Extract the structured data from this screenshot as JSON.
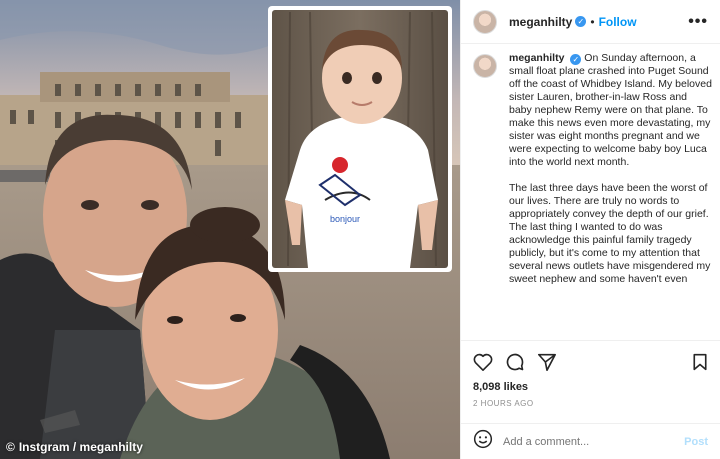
{
  "photo": {
    "credit": "Instgram / meganhilty",
    "child_shirt_text": "bonjour"
  },
  "header": {
    "username": "meganhilty",
    "separator": "•",
    "follow_label": "Follow",
    "more_label": "•••"
  },
  "caption": {
    "username": "meganhilty",
    "paragraph_1": "On Sunday afternoon, a small float plane crashed into Puget Sound off the coast of Whidbey Island.  My beloved sister Lauren, brother-in-law Ross and baby nephew Remy were on that plane.  To make this news even more devastating, my sister was eight months pregnant and we were expecting to welcome baby boy Luca into the world next month.",
    "paragraph_2": "The last three days have been the worst of our lives. There are truly no words to appropriately convey the depth of our grief.  The last thing I wanted to do was acknowledge this painful family tragedy publicly, but it's come to my attention that several news outlets have misgendered my sweet nephew and some haven't even"
  },
  "post": {
    "likes": "8,098 likes",
    "time": "2 HOURS AGO"
  },
  "comment": {
    "placeholder": "Add a comment...",
    "post_label": "Post"
  },
  "colors": {
    "accent": "#0095f6",
    "verified": "#3897f0",
    "muted": "#8e8e8e"
  },
  "icons": [
    "verified-badge-icon",
    "heart-icon",
    "comment-icon",
    "share-icon",
    "bookmark-icon",
    "emoji-icon",
    "instagram-camera-icon"
  ]
}
